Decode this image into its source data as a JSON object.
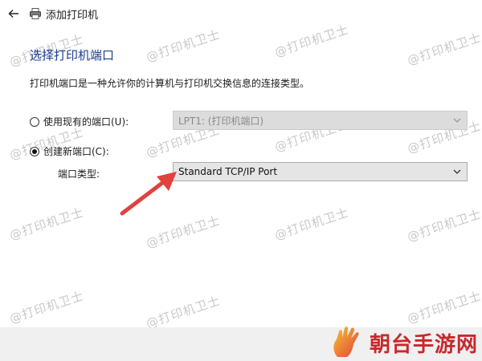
{
  "window": {
    "title": "添加打印机"
  },
  "page": {
    "heading": "选择打印机端口",
    "description": "打印机端口是一种允许你的计算机与打印机交换信息的连接类型。"
  },
  "options": {
    "existing_port": {
      "label": "使用现有的端口(U):",
      "selected": false,
      "value": "LPT1: (打印机端口)"
    },
    "new_port": {
      "label": "创建新端口(C):",
      "selected": true,
      "type_label": "端口类型:",
      "value": "Standard TCP/IP Port"
    }
  },
  "watermark": "@打印机卫士",
  "branding": {
    "logo_text": "朝台手游网"
  },
  "colors": {
    "heading": "#1a3c8f",
    "arrow": "#e0423e",
    "logo": "#c8282d"
  }
}
